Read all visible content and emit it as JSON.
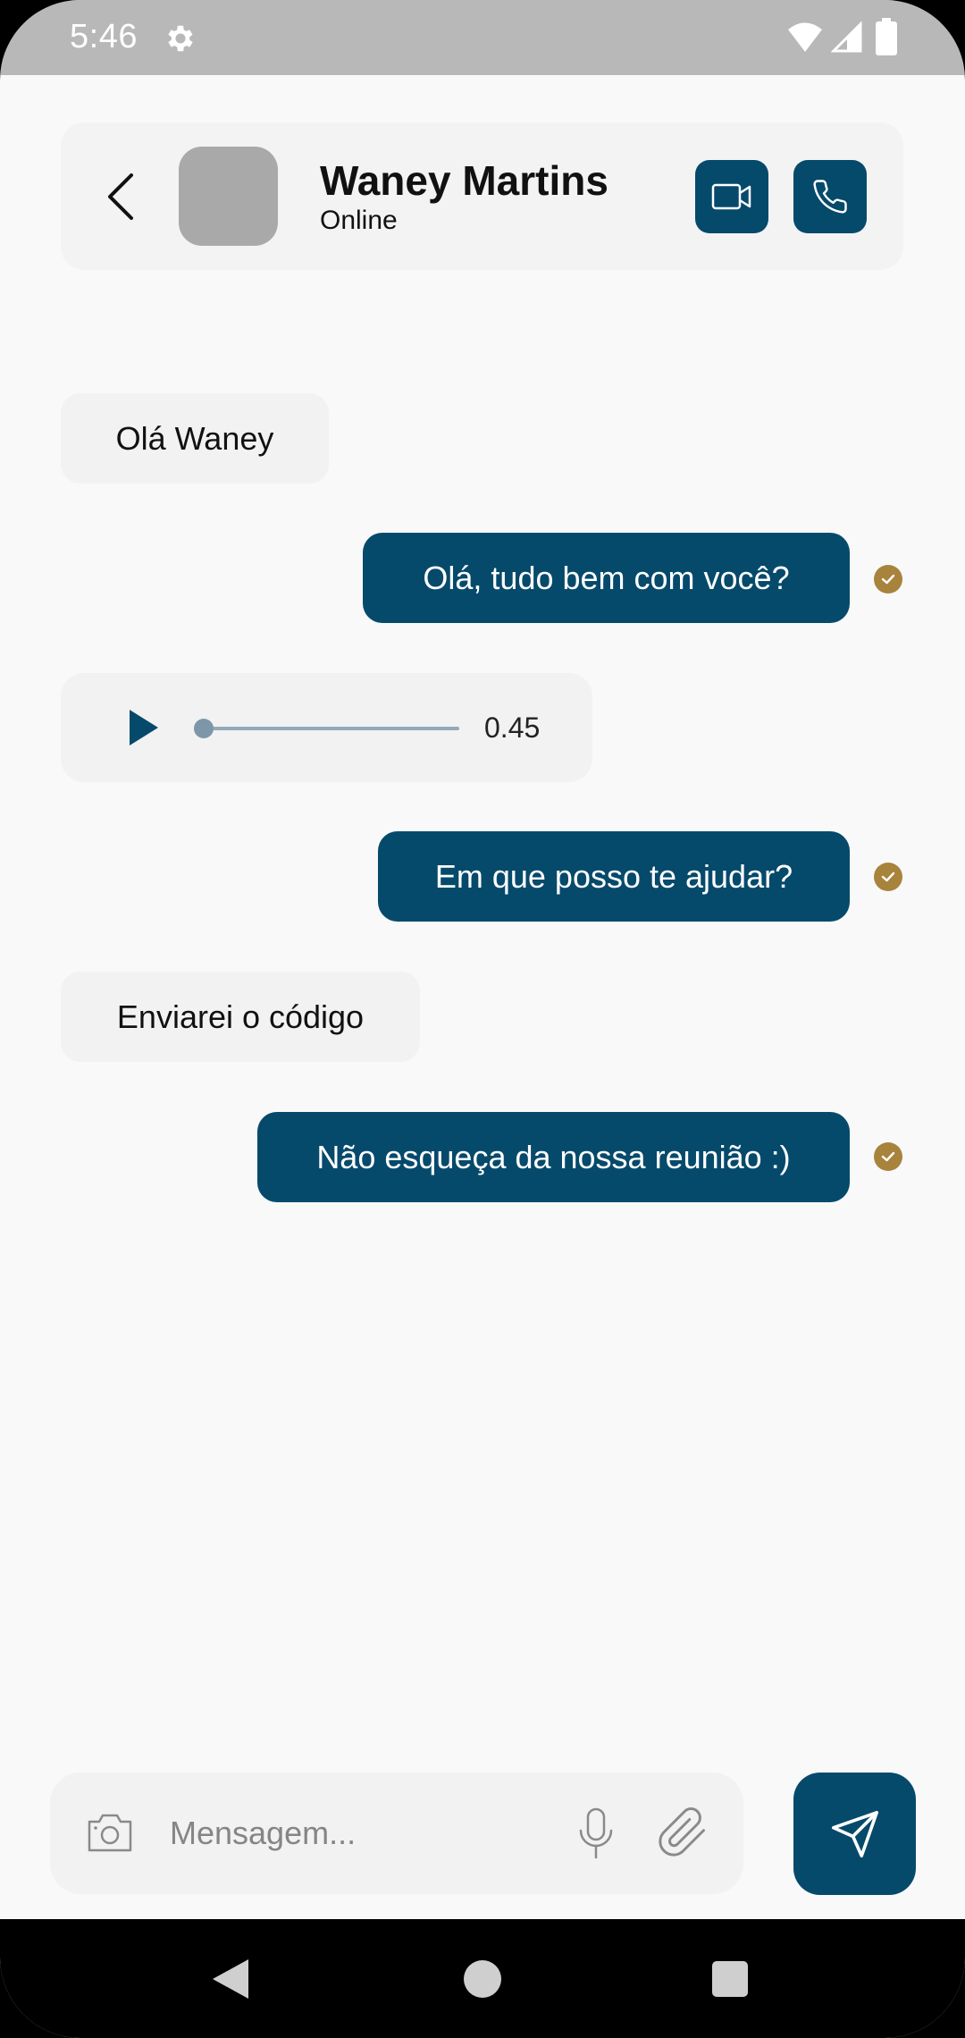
{
  "status_bar": {
    "time": "5:46",
    "icons": [
      "gear-icon",
      "wifi-icon",
      "signal-icon",
      "battery-icon"
    ]
  },
  "header": {
    "contact_name": "Waney Martins",
    "contact_status": "Online",
    "actions": [
      "back-icon",
      "video-call-icon",
      "phone-icon"
    ]
  },
  "messages": [
    {
      "direction": "in",
      "type": "text",
      "text": "Olá Waney"
    },
    {
      "direction": "out",
      "type": "text",
      "text": "Olá, tudo bem com você?",
      "status": "read"
    },
    {
      "direction": "in",
      "type": "audio",
      "duration": "0.45",
      "progress": 0.0
    },
    {
      "direction": "out",
      "type": "text",
      "text": "Em que posso te ajudar?",
      "status": "read"
    },
    {
      "direction": "in",
      "type": "text",
      "text": "Enviarei o código"
    },
    {
      "direction": "out",
      "type": "text",
      "text": "Não esqueça da nossa reunião :)",
      "status": "read"
    }
  ],
  "composer": {
    "placeholder": "Mensagem...",
    "value": "",
    "icons": [
      "camera-icon",
      "microphone-icon",
      "paperclip-icon",
      "send-icon"
    ]
  },
  "colors": {
    "primary": "#064a6b",
    "check": "#a8833c",
    "incoming_bubble": "#f2f2f3",
    "background": "#f9f9fa"
  }
}
